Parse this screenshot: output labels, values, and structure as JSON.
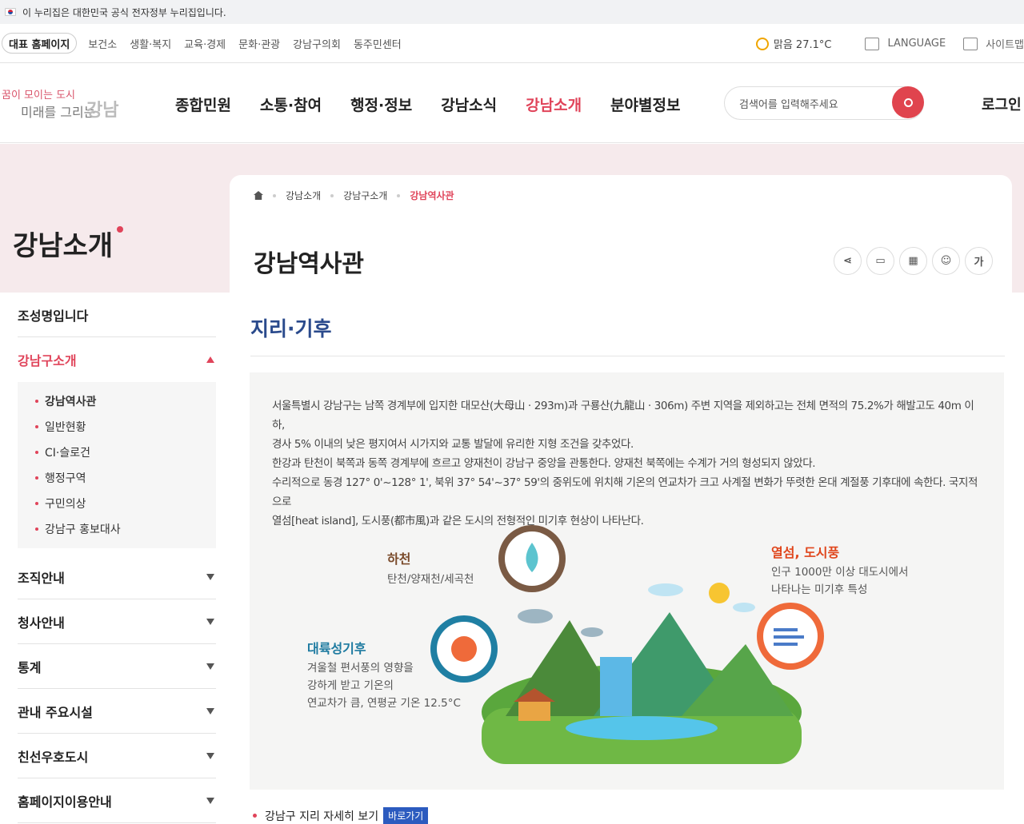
{
  "gov_bar": {
    "text": "이 누리집은 대한민국 공식 전자정부 누리집입니다."
  },
  "util": {
    "home": "대표 홈페이지",
    "links": [
      "보건소",
      "생활·복지",
      "교육·경제",
      "문화·관광",
      "강남구의회",
      "동주민센터"
    ],
    "weather": "맑음  27.1°C",
    "language": "LANGUAGE",
    "sitemap": "사이트맵"
  },
  "logo": {
    "line1": "꿈이 모이는 도시",
    "line2": "미래를 그리는",
    "line3": "강남"
  },
  "menu": [
    "종합민원",
    "소통·참여",
    "행정·정보",
    "강남소식",
    "강남소개",
    "분야별정보"
  ],
  "search": {
    "placeholder": "검색어를 입력해주세요"
  },
  "login": "로그인",
  "hero": {
    "title": "강남소개"
  },
  "breadcrumb": [
    "강남소개",
    "강남구소개",
    "강남역사관"
  ],
  "page_title": "강남역사관",
  "tools": {
    "font": "가"
  },
  "lnb": {
    "top": "조성명입니다",
    "open": "강남구소개",
    "sub": [
      "강남역사관",
      "일반현황",
      "CI·슬로건",
      "행정구역",
      "구민의상",
      "강남구 홍보대사"
    ],
    "rest": [
      "조직안내",
      "청사안내",
      "통계",
      "관내 주요시설",
      "친선우호도시",
      "홈페이지이용안내"
    ]
  },
  "section_title": "지리·기후",
  "paragraph": [
    "서울특별시 강남구는 남쪽 경계부에 입지한 대모산(大母山 · 293m)과 구룡산(九龍山 · 306m) 주변 지역을 제외하고는 전체 면적의 75.2%가 해발고도 40m 이하,",
    "경사 5% 이내의 낮은 평지여서 시가지와 교통 발달에 유리한 지형 조건을 갖추었다.",
    "한강과 탄천이 북쪽과 동쪽 경계부에 흐르고 양재천이 강남구 중앙을 관통한다. 양재천 북쪽에는 수계가 거의 형성되지 않았다.",
    "수리적으로 동경 127° 0'~128° 1', 북위 37° 54'~37° 59'의 중위도에 위치해 기온의 연교차가 크고 사계절 변화가 뚜렷한 온대 계절풍 기후대에 속한다. 국지적으로",
    "열섬[heat island], 도시풍(都市風)과 같은 도시의 전형적인 미기후 현상이 나타난다."
  ],
  "labels": {
    "river": {
      "title": "하천",
      "text": "탄천/양재천/세곡천"
    },
    "heat": {
      "title": "열섬, 도시풍",
      "text1": "인구 1000만 이상 대도시에서",
      "text2": "나타나는 미기후 특성"
    },
    "climate": {
      "title": "대륙성기후",
      "text1": "겨울철 편서풍의 영향을",
      "text2": "강하게 받고 기온의",
      "text3": "연교차가 큼, 연평균 기온 12.5°C"
    }
  },
  "more": {
    "text": "강남구 지리 자세히 보기",
    "button": "바로가기"
  }
}
